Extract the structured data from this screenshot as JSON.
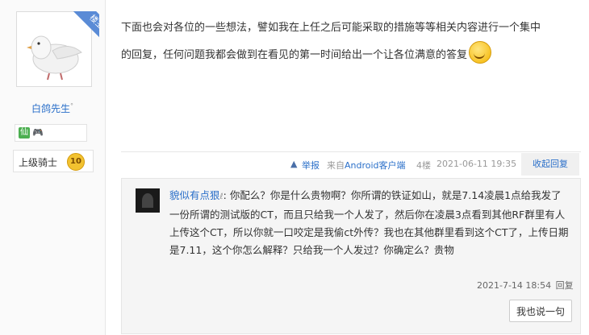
{
  "sidebar": {
    "ribbon": "楼主",
    "username": "白鸽先生",
    "username_mark": "°",
    "medal_a": "仙",
    "medal_b": "🎮",
    "rank_label": "上级骑士",
    "rank_level": "10"
  },
  "post": {
    "line1": "下面也会对各位的一些想法，譬如我在上任之后可能采取的措施等等相关内容进行一个集中",
    "line2": "的回复，任何问题我都会做到在看见的第一时间给出一个让各位满意的答复"
  },
  "meta": {
    "report": "举报",
    "client_prefix": "来自",
    "client_name": "Android客户端",
    "floor": "4楼",
    "timestamp": "2021-06-11 19:35",
    "collapse": "收起回复"
  },
  "reply": {
    "name": "貌似有点狠",
    "tag": "ℓ",
    "text": ": 你配么？你是什么贵物啊？你所谓的铁证如山，就是7.14凌晨1点给我发了一份所谓的测试版的CT，而且只给我一个人发了，然后你在凌晨3点看到其他RF群里有人上传这个CT，所以你就一口咬定是我偷ct外传？我也在其他群里看到这个CT了，上传日期是7.11，这个你怎么解释？只给我一个人发过？你确定么？贵物",
    "timestamp": "2021-7-14 18:54",
    "reply_label": "回复",
    "button": "我也说一句"
  }
}
